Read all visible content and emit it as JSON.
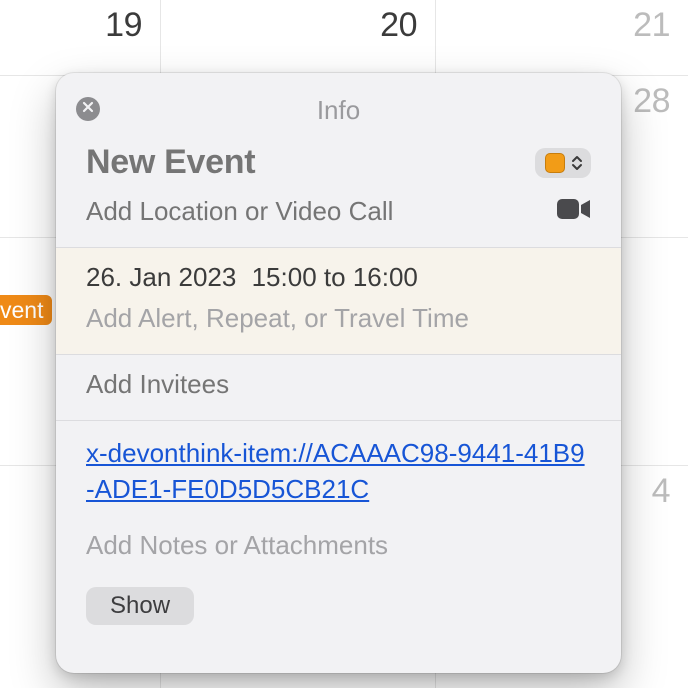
{
  "calendar": {
    "days": {
      "d19": "19",
      "d20": "20",
      "d21": "21",
      "d28": "28",
      "d4": "4"
    },
    "chip_label": "vent"
  },
  "popover": {
    "title": "Info",
    "event_title_placeholder": "New Event",
    "location_placeholder": "Add Location or Video Call",
    "date": "26. Jan 2023",
    "time_start": "15:00",
    "time_to": "to",
    "time_end": "16:00",
    "alert_placeholder": "Add Alert, Repeat, or Travel Time",
    "invitees_placeholder": "Add Invitees",
    "url": "x-devonthink-item://ACAAAC98-9441-41B9-ADE1-FE0D5D5CB21C",
    "notes_placeholder": "Add Notes or Attachments",
    "show_button": "Show",
    "calendar_color": "#f29c17"
  }
}
